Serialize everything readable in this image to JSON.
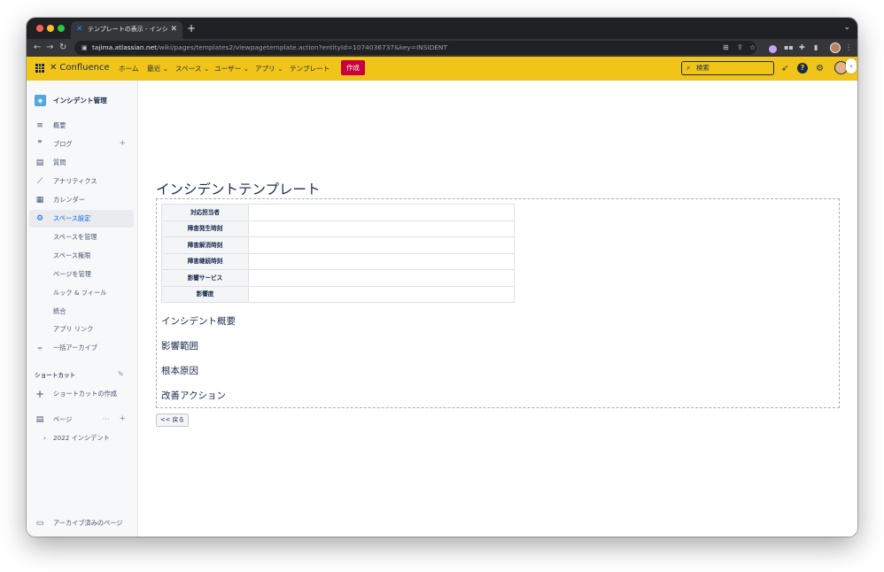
{
  "browser": {
    "tab_title": "テンプレートの表示 - インシデン",
    "tab_close": "✕",
    "new_tab": "+",
    "tab_menu": "⌄",
    "url_host": "tajima.atlassian.net",
    "url_path": "/wiki/pages/templates2/viewpagetemplate.action?entityId=1074036737&key=INSIDENT",
    "back": "←",
    "forward": "→",
    "reload": "↻",
    "lock": "🔒"
  },
  "header": {
    "logo": "Confluence",
    "nav": [
      {
        "label": "ホーム"
      },
      {
        "label": "最近 ⌄"
      },
      {
        "label": "スペース ⌄"
      },
      {
        "label": "ユーザー ⌄"
      },
      {
        "label": "アプリ ⌄"
      },
      {
        "label": "テンプレート"
      }
    ],
    "create": "作成",
    "search_placeholder": "検索"
  },
  "sidebar": {
    "space_name": "インシデント管理",
    "items": [
      {
        "label": "概要",
        "icon": "≡"
      },
      {
        "label": "ブログ",
        "icon": "❞"
      },
      {
        "label": "質問",
        "icon": "▤"
      },
      {
        "label": "アナリティクス",
        "icon": "⟋"
      },
      {
        "label": "カレンダー",
        "icon": "▦"
      },
      {
        "label": "スペース設定",
        "icon": "⚙"
      }
    ],
    "sub_items": [
      {
        "label": "スペースを管理"
      },
      {
        "label": "スペース権限"
      },
      {
        "label": "ページを管理"
      },
      {
        "label": "ルック & フィール"
      },
      {
        "label": "統合"
      },
      {
        "label": "アプリ リンク"
      }
    ],
    "archive_bulk": "一括アーカイブ",
    "shortcuts_title": "ショートカット",
    "create_shortcut": "ショートカットの作成",
    "pages_title": "ページ",
    "page_tree": [
      {
        "label": "2022 インシデント"
      }
    ],
    "archived_pages": "アーカイブ済みのページ"
  },
  "main": {
    "title": "インシデントテンプレート",
    "table_rows": [
      {
        "label": "対応担当者"
      },
      {
        "label": "障害発生時刻"
      },
      {
        "label": "障害解消時刻"
      },
      {
        "label": "障害継続時刻"
      },
      {
        "label": "影響サービス"
      },
      {
        "label": "影響度"
      }
    ],
    "headings": [
      "インシデント概要",
      "影響範囲",
      "根本原因",
      "改善アクション"
    ],
    "back_button": "<< 戻る"
  },
  "colors": {
    "header_bg": "#f0c419",
    "create_btn": "#c9003d",
    "active_blue": "#0c66e4"
  }
}
